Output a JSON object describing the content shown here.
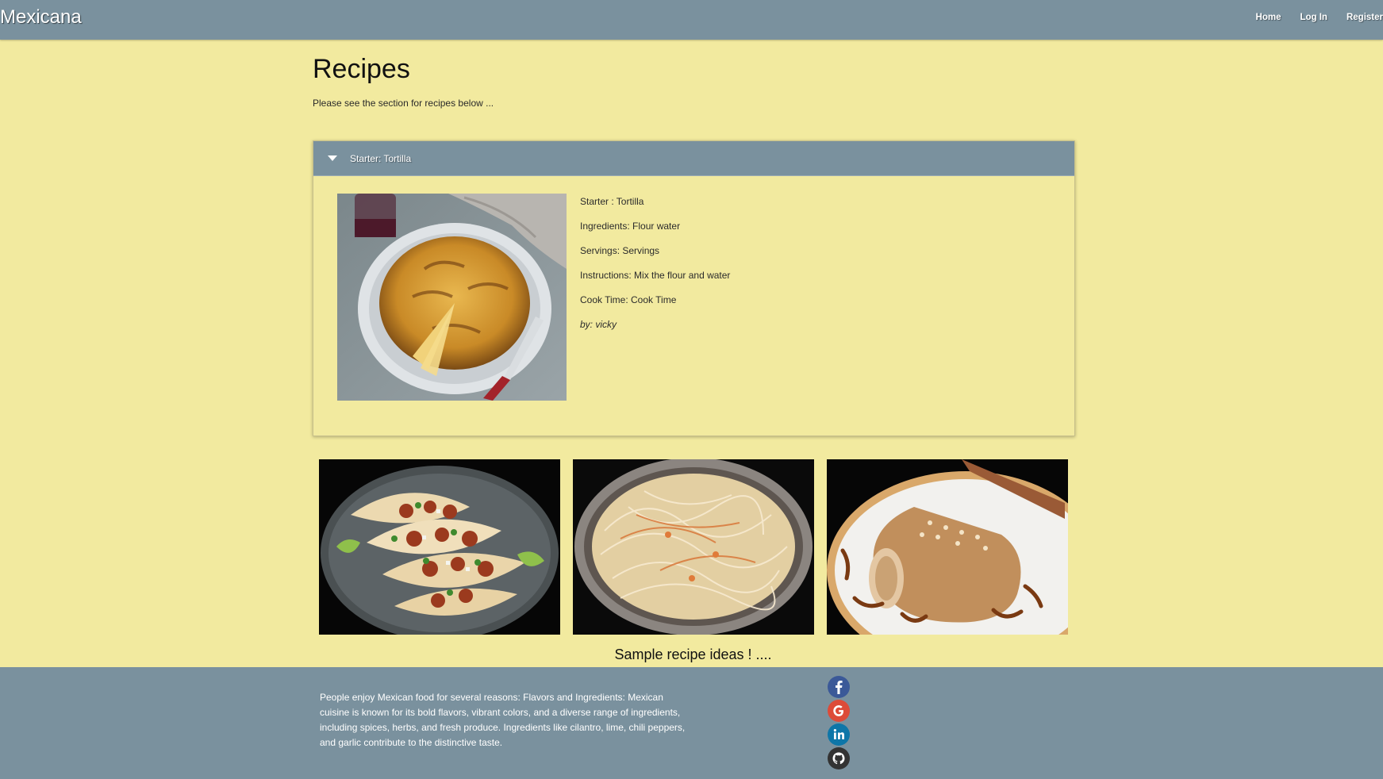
{
  "navbar": {
    "brand": "Mexicana",
    "links": [
      {
        "label": "Home"
      },
      {
        "label": "Log In"
      },
      {
        "label": "Register"
      }
    ]
  },
  "page": {
    "title": "Recipes",
    "subtitle": "Please see the section for recipes below ..."
  },
  "accordion": {
    "title": "Starter: Tortilla",
    "details": {
      "starter": "Starter : Tortilla",
      "ingredients": "Ingredients: Flour water",
      "servings": "Servings: Servings",
      "instructions": "Instructions: Mix the flour and water",
      "cook_time": "Cook Time: Cook Time",
      "author": "by: vicky"
    }
  },
  "gallery": {
    "caption": "Sample recipe ideas ! ...."
  },
  "footer": {
    "text": "People enjoy Mexican food for several reasons: Flavors and Ingredients: Mexican cuisine is known for its bold flavors, vibrant colors, and a diverse range of ingredients, including spices, herbs, and fresh produce. Ingredients like cilantro, lime, chili peppers, and garlic contribute to the distinctive taste.",
    "socials": [
      {
        "icon": "facebook-icon",
        "color": "#3b5998"
      },
      {
        "icon": "google-icon",
        "color": "#dd4b39"
      },
      {
        "icon": "linkedin-icon",
        "color": "#0e76a8"
      },
      {
        "icon": "github-icon",
        "color": "#333333"
      }
    ]
  },
  "colors": {
    "background": "#f2ea9f",
    "navbar": "#7a919e",
    "footer": "#7a919e",
    "accordion_header": "#7a919e"
  }
}
